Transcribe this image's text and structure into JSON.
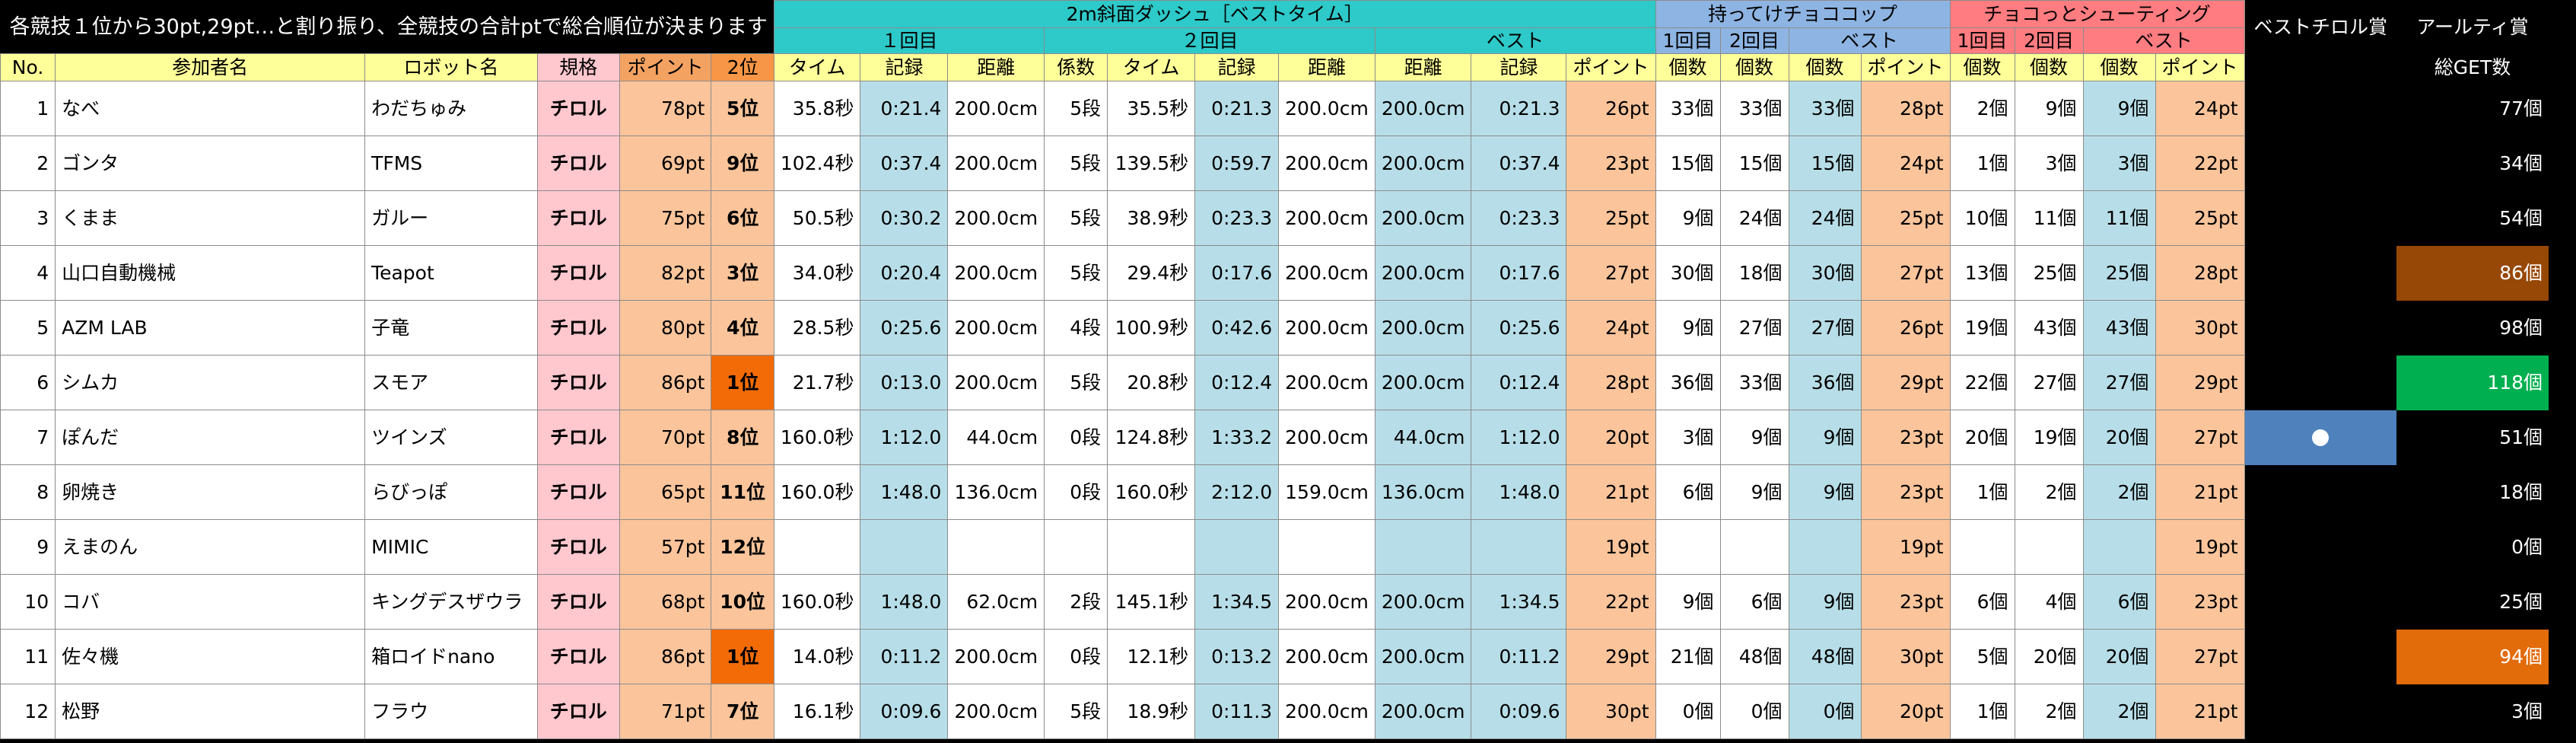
{
  "note": "各競技１位から30pt,29pt…と割り振り、全競技の合計ptで総合順位が決まります",
  "groups": {
    "dash": "2m斜面ダッシュ［ベストタイム］",
    "cup": "持ってけチョココップ",
    "shoot": "チョコっとシューティング",
    "best_chirol": "ベストチロル賞",
    "artistic": "アールティ賞",
    "get_total": "総GET数"
  },
  "sub": {
    "first": "１回目",
    "second": "２回目",
    "best": "ベスト",
    "cup_first": "1回目",
    "cup_second": "2回目",
    "cup_best": "ベスト",
    "sh_first": "1回目",
    "sh_second": "2回目",
    "sh_best": "ベスト"
  },
  "cols": {
    "no": "No.",
    "name": "参加者名",
    "robot": "ロボット名",
    "class": "規格",
    "points": "ポイント",
    "rank": "2位",
    "time": "タイム",
    "record": "記録",
    "distance": "距離",
    "coef": "係数",
    "count": "個数",
    "point": "ポイント"
  },
  "colors": {
    "teal": "#2ec9c9",
    "blue_header": "#8db4e2",
    "red_header": "#ff7c80",
    "yellow": "#ffff99",
    "pink": "#ffc7ce",
    "orange": "#fbc49a",
    "light_blue": "#b7dee8",
    "rank1": "#f26b07",
    "award_brown": "#974706",
    "award_green": "#00b050",
    "award_orange": "#e26b0a",
    "award_blue": "#4f81bd"
  },
  "rows": [
    {
      "no": "1",
      "name": "なべ",
      "robot": "わだちゅみ",
      "class": "チロル",
      "points": "78pt",
      "rank": "5位",
      "t1": "35.8秒",
      "r1": "0:21.4",
      "d1": "200.0cm",
      "k": "5段",
      "t2": "35.5秒",
      "r2": "0:21.3",
      "d2": "200.0cm",
      "bd": "200.0cm",
      "br": "0:21.3",
      "dp": "26pt",
      "c1": "33個",
      "c2": "33個",
      "cb": "33個",
      "cp": "28pt",
      "s1": "2個",
      "s2": "9個",
      "sb": "9個",
      "sp": "24pt",
      "get": "77個"
    },
    {
      "no": "2",
      "name": "ゴンタ",
      "robot": "TFMS",
      "class": "チロル",
      "points": "69pt",
      "rank": "9位",
      "t1": "102.4秒",
      "r1": "0:37.4",
      "d1": "200.0cm",
      "k": "5段",
      "t2": "139.5秒",
      "r2": "0:59.7",
      "d2": "200.0cm",
      "bd": "200.0cm",
      "br": "0:37.4",
      "dp": "23pt",
      "c1": "15個",
      "c2": "15個",
      "cb": "15個",
      "cp": "24pt",
      "s1": "1個",
      "s2": "3個",
      "sb": "3個",
      "sp": "22pt",
      "get": "34個"
    },
    {
      "no": "3",
      "name": "くまま",
      "robot": "ガルー",
      "class": "チロル",
      "points": "75pt",
      "rank": "6位",
      "t1": "50.5秒",
      "r1": "0:30.2",
      "d1": "200.0cm",
      "k": "5段",
      "t2": "38.9秒",
      "r2": "0:23.3",
      "d2": "200.0cm",
      "bd": "200.0cm",
      "br": "0:23.3",
      "dp": "25pt",
      "c1": "9個",
      "c2": "24個",
      "cb": "24個",
      "cp": "25pt",
      "s1": "10個",
      "s2": "11個",
      "sb": "11個",
      "sp": "25pt",
      "get": "54個"
    },
    {
      "no": "4",
      "name": "山口自動機械",
      "robot": "Teapot",
      "class": "チロル",
      "points": "82pt",
      "rank": "3位",
      "t1": "34.0秒",
      "r1": "0:20.4",
      "d1": "200.0cm",
      "k": "5段",
      "t2": "29.4秒",
      "r2": "0:17.6",
      "d2": "200.0cm",
      "bd": "200.0cm",
      "br": "0:17.6",
      "dp": "27pt",
      "c1": "30個",
      "c2": "18個",
      "cb": "30個",
      "cp": "27pt",
      "s1": "13個",
      "s2": "25個",
      "sb": "25個",
      "sp": "28pt",
      "get": "86個"
    },
    {
      "no": "5",
      "name": "AZM LAB",
      "robot": "子竜",
      "class": "チロル",
      "points": "80pt",
      "rank": "4位",
      "t1": "28.5秒",
      "r1": "0:25.6",
      "d1": "200.0cm",
      "k": "4段",
      "t2": "100.9秒",
      "r2": "0:42.6",
      "d2": "200.0cm",
      "bd": "200.0cm",
      "br": "0:25.6",
      "dp": "24pt",
      "c1": "9個",
      "c2": "27個",
      "cb": "27個",
      "cp": "26pt",
      "s1": "19個",
      "s2": "43個",
      "sb": "43個",
      "sp": "30pt",
      "get": "98個"
    },
    {
      "no": "6",
      "name": "シムカ",
      "robot": "スモア",
      "class": "チロル",
      "points": "86pt",
      "rank": "1位",
      "t1": "21.7秒",
      "r1": "0:13.0",
      "d1": "200.0cm",
      "k": "5段",
      "t2": "20.8秒",
      "r2": "0:12.4",
      "d2": "200.0cm",
      "bd": "200.0cm",
      "br": "0:12.4",
      "dp": "28pt",
      "c1": "36個",
      "c2": "33個",
      "cb": "36個",
      "cp": "29pt",
      "s1": "22個",
      "s2": "27個",
      "sb": "27個",
      "sp": "29pt",
      "get": "118個"
    },
    {
      "no": "7",
      "name": "ぽんだ",
      "robot": "ツインズ",
      "class": "チロル",
      "points": "70pt",
      "rank": "8位",
      "t1": "160.0秒",
      "r1": "1:12.0",
      "d1": "44.0cm",
      "k": "0段",
      "t2": "124.8秒",
      "r2": "1:33.2",
      "d2": "200.0cm",
      "bd": "44.0cm",
      "br": "1:12.0",
      "dp": "20pt",
      "c1": "3個",
      "c2": "9個",
      "cb": "9個",
      "cp": "23pt",
      "s1": "20個",
      "s2": "19個",
      "sb": "20個",
      "sp": "27pt",
      "get": "51個"
    },
    {
      "no": "8",
      "name": "卵焼き",
      "robot": "らびっぽ",
      "class": "チロル",
      "points": "65pt",
      "rank": "11位",
      "t1": "160.0秒",
      "r1": "1:48.0",
      "d1": "136.0cm",
      "k": "0段",
      "t2": "160.0秒",
      "r2": "2:12.0",
      "d2": "159.0cm",
      "bd": "136.0cm",
      "br": "1:48.0",
      "dp": "21pt",
      "c1": "6個",
      "c2": "9個",
      "cb": "9個",
      "cp": "23pt",
      "s1": "1個",
      "s2": "2個",
      "sb": "2個",
      "sp": "21pt",
      "get": "18個"
    },
    {
      "no": "9",
      "name": "えまのん",
      "robot": "MIMIC",
      "class": "チロル",
      "points": "57pt",
      "rank": "12位",
      "t1": "",
      "r1": "",
      "d1": "",
      "k": "",
      "t2": "",
      "r2": "",
      "d2": "",
      "bd": "",
      "br": "",
      "dp": "19pt",
      "c1": "",
      "c2": "",
      "cb": "",
      "cp": "19pt",
      "s1": "",
      "s2": "",
      "sb": "",
      "sp": "19pt",
      "get": "0個"
    },
    {
      "no": "10",
      "name": "コバ",
      "robot": "キングデスザウラ",
      "class": "チロル",
      "points": "68pt",
      "rank": "10位",
      "t1": "160.0秒",
      "r1": "1:48.0",
      "d1": "62.0cm",
      "k": "2段",
      "t2": "145.1秒",
      "r2": "1:34.5",
      "d2": "200.0cm",
      "bd": "200.0cm",
      "br": "1:34.5",
      "dp": "22pt",
      "c1": "9個",
      "c2": "6個",
      "cb": "9個",
      "cp": "23pt",
      "s1": "6個",
      "s2": "4個",
      "sb": "6個",
      "sp": "23pt",
      "get": "25個"
    },
    {
      "no": "11",
      "name": "佐々機",
      "robot": "箱ロイドnano",
      "class": "チロル",
      "points": "86pt",
      "rank": "1位",
      "t1": "14.0秒",
      "r1": "0:11.2",
      "d1": "200.0cm",
      "k": "0段",
      "t2": "12.1秒",
      "r2": "0:13.2",
      "d2": "200.0cm",
      "bd": "200.0cm",
      "br": "0:11.2",
      "dp": "29pt",
      "c1": "21個",
      "c2": "48個",
      "cb": "48個",
      "cp": "30pt",
      "s1": "5個",
      "s2": "20個",
      "sb": "20個",
      "sp": "27pt",
      "get": "94個"
    },
    {
      "no": "12",
      "name": "松野",
      "robot": "フラウ",
      "class": "チロル",
      "points": "71pt",
      "rank": "7位",
      "t1": "16.1秒",
      "r1": "0:09.6",
      "d1": "200.0cm",
      "k": "5段",
      "t2": "18.9秒",
      "r2": "0:11.3",
      "d2": "200.0cm",
      "bd": "200.0cm",
      "br": "0:09.6",
      "dp": "30pt",
      "c1": "0個",
      "c2": "0個",
      "cb": "0個",
      "cp": "20pt",
      "s1": "1個",
      "s2": "2個",
      "sb": "2個",
      "sp": "21pt",
      "get": "3個"
    }
  ],
  "awards": {
    "best_chirol_row": 7,
    "artistic_rows": [
      {
        "row": 4,
        "color": "#974706"
      },
      {
        "row": 6,
        "color": "#00b050"
      },
      {
        "row": 11,
        "color": "#e26b0a"
      }
    ],
    "best_chirol_color": "#4f81bd"
  }
}
